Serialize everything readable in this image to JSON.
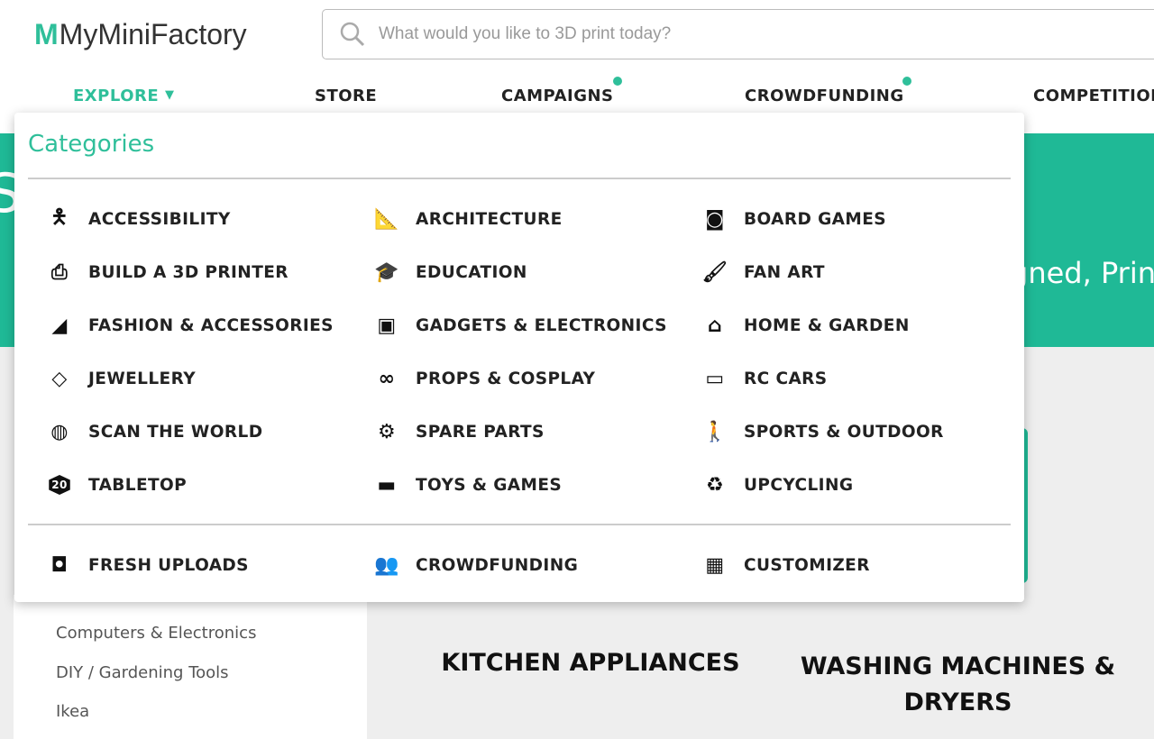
{
  "header": {
    "logo_text": "MyMiniFactory",
    "search_placeholder": "What would you like to 3D print today?",
    "nav": [
      {
        "label": "EXPLORE",
        "active": true
      },
      {
        "label": "STORE"
      },
      {
        "label": "CAMPAIGNS",
        "has_dot": true
      },
      {
        "label": "CROWDFUNDING",
        "has_dot": true
      },
      {
        "label": "COMPETITIONS"
      }
    ],
    "accent_color": "#2fbf9a"
  },
  "hero": {
    "subtitle_fragment": "gned, Prin",
    "title_fragment": "S"
  },
  "menu": {
    "title": "Categories",
    "categories": [
      {
        "label": "ACCESSIBILITY",
        "icon": "accessibility-icon"
      },
      {
        "label": "ARCHITECTURE",
        "icon": "ruler-icon"
      },
      {
        "label": "BOARD GAMES",
        "icon": "whistle-icon"
      },
      {
        "label": "BUILD A 3D PRINTER",
        "icon": "printer-icon"
      },
      {
        "label": "EDUCATION",
        "icon": "graduation-cap-icon"
      },
      {
        "label": "FAN ART",
        "icon": "paintbrush-icon"
      },
      {
        "label": "FASHION & ACCESSORIES",
        "icon": "high-heel-icon"
      },
      {
        "label": "GADGETS & ELECTRONICS",
        "icon": "gamepad-icon"
      },
      {
        "label": "HOME & GARDEN",
        "icon": "home-icon"
      },
      {
        "label": "JEWELLERY",
        "icon": "diamond-icon"
      },
      {
        "label": "PROPS & COSPLAY",
        "icon": "mask-icon"
      },
      {
        "label": "RC CARS",
        "icon": "car-icon"
      },
      {
        "label": "SCAN THE WORLD",
        "icon": "globe-icon"
      },
      {
        "label": "SPARE PARTS",
        "icon": "gear-icon"
      },
      {
        "label": "SPORTS & OUTDOOR",
        "icon": "hiker-icon"
      },
      {
        "label": "TABLETOP",
        "icon": "d20-icon",
        "icon_text": "20"
      },
      {
        "label": "TOYS & GAMES",
        "icon": "toy-car-icon"
      },
      {
        "label": "UPCYCLING",
        "icon": "recycle-icon"
      }
    ],
    "footer": [
      {
        "label": "FRESH UPLOADS",
        "icon": "camera-icon"
      },
      {
        "label": "CROWDFUNDING",
        "icon": "people-icon"
      },
      {
        "label": "CUSTOMIZER",
        "icon": "dashboard-icon"
      }
    ]
  },
  "sidebar": {
    "items": [
      "Computers & Electronics",
      "DIY / Gardening Tools",
      "Ikea"
    ]
  },
  "cards": [
    "KITCHEN APPLIANCES",
    "WASHING MACHINES & DRYERS"
  ]
}
